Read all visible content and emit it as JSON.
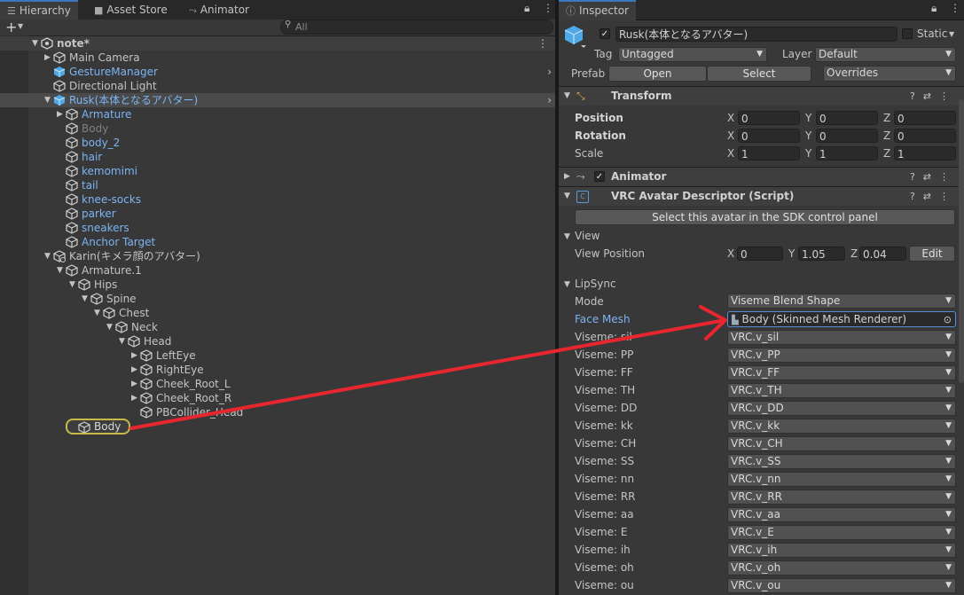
{
  "hierarchy": {
    "tabs": [
      {
        "label": "Hierarchy",
        "icon": "list-icon"
      },
      {
        "label": "Asset Store",
        "icon": "bag-icon"
      },
      {
        "label": "Animator",
        "icon": "animator-icon"
      }
    ],
    "search_placeholder": "All",
    "add_label": "+",
    "rows": [
      {
        "label": "note*",
        "depth": 0,
        "arrow": "down",
        "icon": "unity-scene",
        "style": "scene"
      },
      {
        "label": "Main Camera",
        "depth": 1,
        "arrow": "right",
        "icon": "cube-outline"
      },
      {
        "label": "GestureManager",
        "depth": 1,
        "arrow": "",
        "icon": "cube-blue",
        "style": "blue",
        "chevron": true
      },
      {
        "label": "Directional Light",
        "depth": 1,
        "arrow": "",
        "icon": "cube-outline"
      },
      {
        "label": "Rusk(本体となるアバター)",
        "depth": 1,
        "arrow": "down",
        "icon": "cube-blue",
        "style": "sel",
        "chevron": true
      },
      {
        "label": "Armature",
        "depth": 2,
        "arrow": "right",
        "icon": "cube-outline",
        "style": "blue"
      },
      {
        "label": "Body",
        "depth": 2,
        "arrow": "",
        "icon": "cube-outline",
        "style": "grey"
      },
      {
        "label": "body_2",
        "depth": 2,
        "arrow": "",
        "icon": "cube-outline",
        "style": "blue"
      },
      {
        "label": "hair",
        "depth": 2,
        "arrow": "",
        "icon": "cube-outline",
        "style": "blue"
      },
      {
        "label": "kemomimi",
        "depth": 2,
        "arrow": "",
        "icon": "cube-outline",
        "style": "blue"
      },
      {
        "label": "tail",
        "depth": 2,
        "arrow": "",
        "icon": "cube-outline",
        "style": "blue"
      },
      {
        "label": "knee-socks",
        "depth": 2,
        "arrow": "",
        "icon": "cube-outline",
        "style": "blue"
      },
      {
        "label": "parker",
        "depth": 2,
        "arrow": "",
        "icon": "cube-outline",
        "style": "blue"
      },
      {
        "label": "sneakers",
        "depth": 2,
        "arrow": "",
        "icon": "cube-outline",
        "style": "blue"
      },
      {
        "label": "Anchor Target",
        "depth": 2,
        "arrow": "",
        "icon": "cube-outline",
        "style": "blue"
      },
      {
        "label": "Karin(キメラ顔のアバター)",
        "depth": 1,
        "arrow": "down",
        "icon": "cube-gear"
      },
      {
        "label": "Armature.1",
        "depth": 2,
        "arrow": "down",
        "icon": "cube-outline"
      },
      {
        "label": "Hips",
        "depth": 3,
        "arrow": "down",
        "icon": "cube-outline"
      },
      {
        "label": "Spine",
        "depth": 4,
        "arrow": "down",
        "icon": "cube-outline"
      },
      {
        "label": "Chest",
        "depth": 5,
        "arrow": "down",
        "icon": "cube-outline"
      },
      {
        "label": "Neck",
        "depth": 6,
        "arrow": "down",
        "icon": "cube-outline"
      },
      {
        "label": "Head",
        "depth": 7,
        "arrow": "down",
        "icon": "cube-outline"
      },
      {
        "label": "LeftEye",
        "depth": 8,
        "arrow": "right",
        "icon": "cube-outline"
      },
      {
        "label": "RightEye",
        "depth": 8,
        "arrow": "right",
        "icon": "cube-outline"
      },
      {
        "label": "Cheek_Root_L",
        "depth": 8,
        "arrow": "right",
        "icon": "cube-outline"
      },
      {
        "label": "Cheek_Root_R",
        "depth": 8,
        "arrow": "right",
        "icon": "cube-outline"
      },
      {
        "label": "PBCollider_Head",
        "depth": 8,
        "arrow": "",
        "icon": "cube-outline"
      }
    ],
    "drag_item": {
      "label": "Body",
      "icon": "cube-outline"
    }
  },
  "inspector": {
    "tab": {
      "label": "Inspector",
      "icon": "info-icon"
    },
    "object": {
      "name": "Rusk(本体となるアバター)",
      "active": true,
      "static_label": "Static",
      "tag_label": "Tag",
      "tag_value": "Untagged",
      "layer_label": "Layer",
      "layer_value": "Default",
      "prefab_label": "Prefab",
      "open_label": "Open",
      "select_label": "Select",
      "overrides_label": "Overrides"
    },
    "transform": {
      "title": "Transform",
      "rows": [
        {
          "label": "Position",
          "x": "0",
          "y": "0",
          "z": "0",
          "bold": true
        },
        {
          "label": "Rotation",
          "x": "0",
          "y": "0",
          "z": "0",
          "bold": true
        },
        {
          "label": "Scale",
          "x": "1",
          "y": "1",
          "z": "1",
          "bold": false
        }
      ]
    },
    "animator": {
      "title": "Animator",
      "enabled": true
    },
    "descriptor": {
      "title": "VRC Avatar Descriptor (Script)",
      "select_avatar_label": "Select this avatar in the SDK control panel",
      "view_section": "View",
      "view_position_label": "View Position",
      "view_x": "0",
      "view_y": "1.05",
      "view_z": "0.04",
      "edit_label": "Edit",
      "lipsync_section": "LipSync",
      "mode_label": "Mode",
      "mode_value": "Viseme Blend Shape",
      "face_mesh_label": "Face Mesh",
      "face_mesh_value": "Body (Skinned Mesh Renderer)",
      "visemes": [
        {
          "label": "Viseme: sil",
          "value": "VRC.v_sil"
        },
        {
          "label": "Viseme: PP",
          "value": "VRC.v_PP"
        },
        {
          "label": "Viseme: FF",
          "value": "VRC.v_FF"
        },
        {
          "label": "Viseme: TH",
          "value": "VRC.v_TH"
        },
        {
          "label": "Viseme: DD",
          "value": "VRC.v_DD"
        },
        {
          "label": "Viseme: kk",
          "value": "VRC.v_kk"
        },
        {
          "label": "Viseme: CH",
          "value": "VRC.v_CH"
        },
        {
          "label": "Viseme: SS",
          "value": "VRC.v_SS"
        },
        {
          "label": "Viseme: nn",
          "value": "VRC.v_nn"
        },
        {
          "label": "Viseme: RR",
          "value": "VRC.v_RR"
        },
        {
          "label": "Viseme: aa",
          "value": "VRC.v_aa"
        },
        {
          "label": "Viseme: E",
          "value": "VRC.v_E"
        },
        {
          "label": "Viseme: ih",
          "value": "VRC.v_ih"
        },
        {
          "label": "Viseme: oh",
          "value": "VRC.v_oh"
        },
        {
          "label": "Viseme: ou",
          "value": "VRC.v_ou"
        }
      ]
    }
  },
  "colors": {
    "background": "#383838",
    "tab_bar": "#282828",
    "field": "#2a2a2a",
    "prefab_blue": "#7cb4f4",
    "annotation_arrow": "#e8262f",
    "highlight_outline": "#c9b84a"
  }
}
